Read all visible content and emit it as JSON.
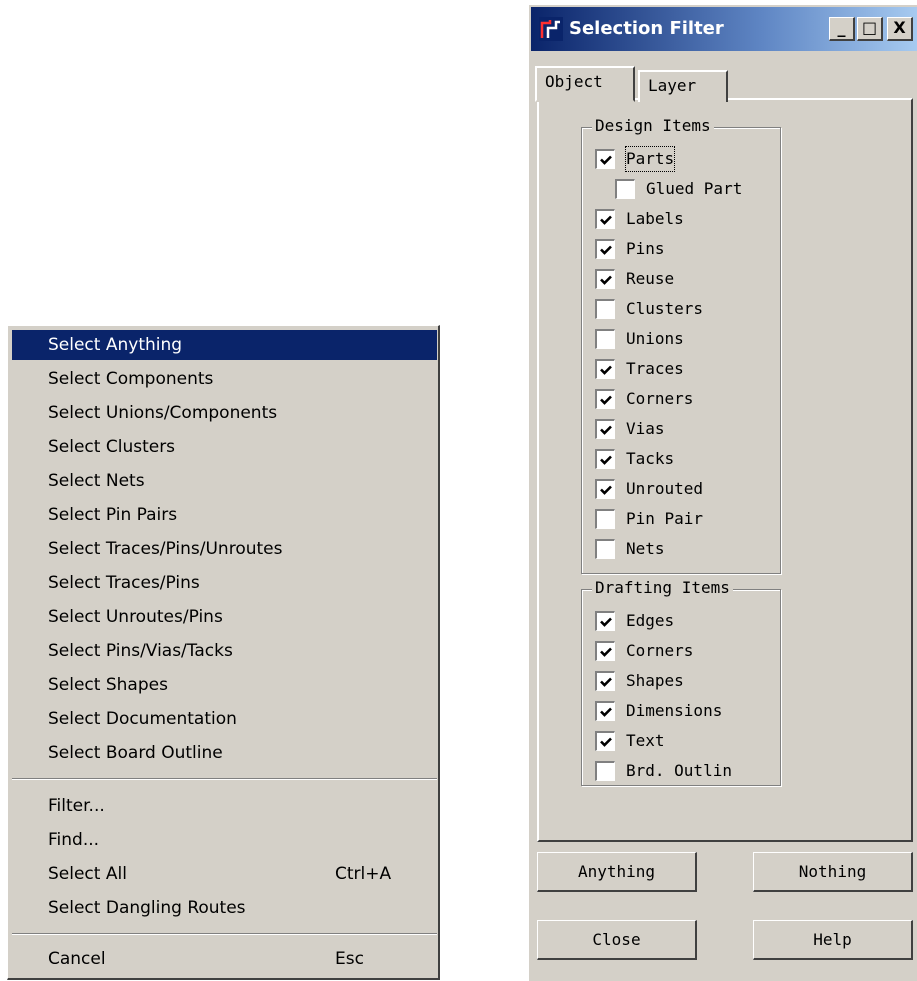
{
  "menu": {
    "items": [
      {
        "label": "Select Anything"
      },
      {
        "label": "Select Components"
      },
      {
        "label": "Select Unions/Components"
      },
      {
        "label": "Select Clusters"
      },
      {
        "label": "Select Nets"
      },
      {
        "label": "Select Pin Pairs"
      },
      {
        "label": "Select Traces/Pins/Unroutes"
      },
      {
        "label": "Select Traces/Pins"
      },
      {
        "label": "Select Unroutes/Pins"
      },
      {
        "label": "Select Pins/Vias/Tacks"
      },
      {
        "label": "Select Shapes"
      },
      {
        "label": "Select Documentation"
      },
      {
        "label": "Select Board Outline"
      }
    ],
    "items2": [
      {
        "label": "Filter..."
      },
      {
        "label": "Find..."
      },
      {
        "label": "Select All",
        "shortcut": "Ctrl+A"
      },
      {
        "label": "Select Dangling Routes"
      }
    ],
    "items3": [
      {
        "label": "Cancel",
        "shortcut": "Esc"
      }
    ],
    "active_item": "Select Anything",
    "highlight_color": "#0a246a"
  },
  "dialog": {
    "title": "Selection Filter",
    "caption_buttons": {
      "minimize": "_",
      "maximize": "□",
      "close": "X"
    },
    "tabs": [
      {
        "label": "Object"
      },
      {
        "label": "Layer"
      }
    ],
    "active_tab": "Object",
    "design_group": {
      "title": "Design Items",
      "items": [
        {
          "label": "Parts",
          "checked": true
        },
        {
          "label": "Glued Part",
          "checked": false
        },
        {
          "label": "Labels",
          "checked": true
        },
        {
          "label": "Pins",
          "checked": true
        },
        {
          "label": "Reuse",
          "checked": true
        },
        {
          "label": "Clusters",
          "checked": false
        },
        {
          "label": "Unions",
          "checked": false
        },
        {
          "label": "Traces",
          "checked": true
        },
        {
          "label": "Corners",
          "checked": true
        },
        {
          "label": "Vias",
          "checked": true
        },
        {
          "label": "Tacks",
          "checked": true
        },
        {
          "label": "Unrouted",
          "checked": true
        },
        {
          "label": "Pin Pair",
          "checked": false
        },
        {
          "label": "Nets",
          "checked": false
        }
      ]
    },
    "drafting_group": {
      "title": "Drafting Items",
      "items": [
        {
          "label": "Edges",
          "checked": true
        },
        {
          "label": "Corners",
          "checked": true
        },
        {
          "label": "Shapes",
          "checked": true
        },
        {
          "label": "Dimensions",
          "checked": true
        },
        {
          "label": "Text",
          "checked": true
        },
        {
          "label": "Brd. Outlin",
          "checked": false
        }
      ]
    },
    "buttons": {
      "anything": "Anything",
      "nothing": "Nothing",
      "close": "Close",
      "help": "Help"
    }
  }
}
